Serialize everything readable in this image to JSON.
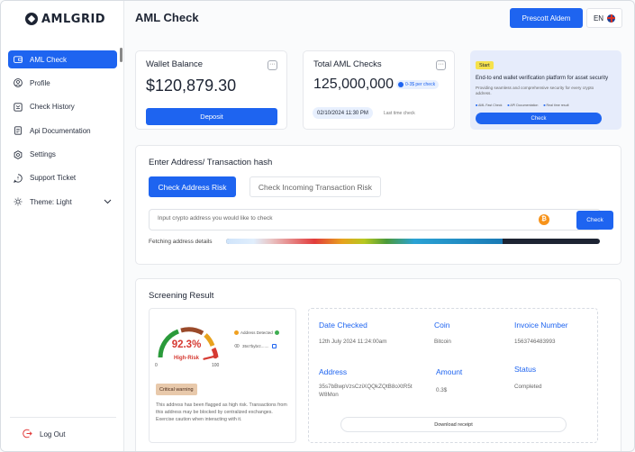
{
  "app": {
    "logo_text": "AMLGRID"
  },
  "sidebar": {
    "items": [
      {
        "label": "AML Check",
        "icon": "wallet-icon",
        "active": true
      },
      {
        "label": "Profile",
        "icon": "user-icon"
      },
      {
        "label": "Check History",
        "icon": "history-icon"
      },
      {
        "label": "Api Documentation",
        "icon": "document-icon"
      },
      {
        "label": "Settings",
        "icon": "gear-icon"
      },
      {
        "label": "Support Ticket",
        "icon": "chat-icon"
      },
      {
        "label": "Theme: Light",
        "icon": "sun-icon"
      }
    ],
    "logout_label": "Log Out"
  },
  "header": {
    "title": "AML Check",
    "user_name": "Prescott Aldem",
    "language": "EN"
  },
  "wallet": {
    "title": "Wallet Balance",
    "amount": "$120,879.30",
    "deposit_label": "Deposit"
  },
  "aml_total": {
    "title": "Total AML Checks",
    "amount": "125,000,000",
    "price_badge": "0-3$ per check",
    "date": "02/10/2024 11:30 PM",
    "date_note": "Last time check"
  },
  "promo": {
    "badge": "Start",
    "title": "End-to end wallet verification platform for asset security",
    "description": "Providing seamless and comprehensive security for every crypto address.",
    "features": [
      "AML Fast Check",
      "API Documentation",
      "Real time result"
    ],
    "button_label": "Check"
  },
  "address_check": {
    "title": "Enter Address/ Transaction hash",
    "tab_active": "Check Address Risk",
    "tab_idle": "Check Incoming Transaction Risk",
    "input_placeholder": "Input crypto address you would like to check",
    "check_label": "Check",
    "fetch_label": "Fetching address details",
    "fetch_progress": 0.74
  },
  "screening": {
    "title": "Screening Result",
    "risk_percent": 92.3,
    "risk_value": "92.3%",
    "risk_label": "High-Risk",
    "gauge_min": "0",
    "gauge_max": "100",
    "address_detected": "Address Detected",
    "address_short": "35s7bybrz.......",
    "critical_badge": "Critical warning",
    "critical_text": "This address has been flagged as high risk. Transactions from this address may be blocked by centralized exchanges. Exercise caution when interacting with it.",
    "details": {
      "date_label": "Date Checked",
      "date_value": "12th July 2024 11:24:00am",
      "coin_label": "Coin",
      "coin_value": "Bitcoin",
      "invoice_label": "Invoice Number",
      "invoice_value": "1563746483993",
      "address_label": "Address",
      "address_value": "35s7bBwpVzsCziXQQkZQtB8oXtR5tW8Mon",
      "amount_label": "Amount",
      "amount_value": "0.3$",
      "status_label": "Status",
      "status_value": "Completed"
    },
    "download_label": "Download receipt"
  },
  "colors": {
    "accent": "#1e64f0",
    "risk": "#d63a32",
    "gauge_green": "#2a9a3a",
    "gauge_brown": "#9a4a2a",
    "gauge_orange": "#e8a21d",
    "gauge_red": "#d63a32"
  }
}
